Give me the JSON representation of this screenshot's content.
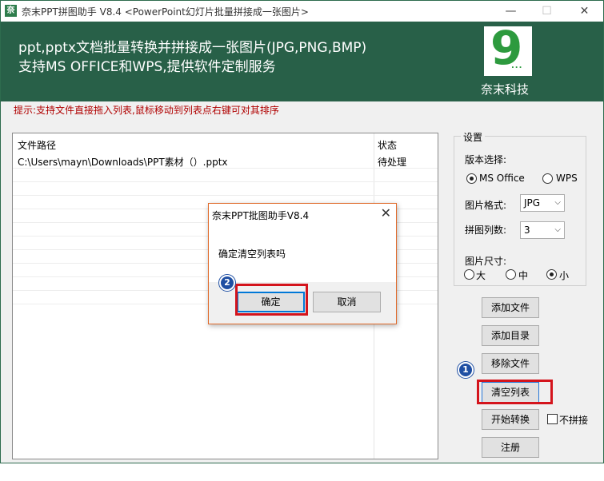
{
  "window": {
    "title": "奈末PPT拼图助手 V8.4 <PowerPoint幻灯片批量拼接成一张图片>",
    "icon_label": "奈",
    "controls": {
      "minimize": "—",
      "maximize": "☐",
      "close": "✕"
    }
  },
  "banner": {
    "line1": "ppt,pptx文档批量转换并拼接成一张图片(JPG,PNG,BMP)",
    "line2": "支持MS OFFICE和WPS,提供软件定制服务",
    "logo_number": "9",
    "logo_dots": "...",
    "logo_text": "奈末科技"
  },
  "hint": "提示:支持文件直接拖入列表,鼠标移动到列表点右键可对其排序",
  "file_list": {
    "columns": [
      "文件路径",
      "状态"
    ],
    "rows": [
      {
        "path": "C:\\Users\\mayn\\Downloads\\PPT素材（）.pptx",
        "status": "待处理"
      }
    ]
  },
  "settings": {
    "title": "设置",
    "version_label": "版本选择:",
    "version_options": [
      "MS Office",
      "WPS"
    ],
    "version_selected": "MS Office",
    "format_label": "图片格式:",
    "format_value": "JPG",
    "columns_label": "拼图列数:",
    "columns_value": "3",
    "size_label": "图片尺寸:",
    "size_options": [
      "大",
      "中",
      "小"
    ],
    "size_selected": "小"
  },
  "buttons": {
    "add_file": "添加文件",
    "add_dir": "添加目录",
    "remove_file": "移除文件",
    "clear_list": "清空列表",
    "start": "开始转换",
    "register": "注册",
    "no_stitch": "不拼接"
  },
  "dialog": {
    "title": "奈末PPT批图助手V8.4",
    "close": "✕",
    "message": "确定清空列表吗",
    "ok": "确定",
    "cancel": "取消"
  },
  "annotations": {
    "badge1": "1",
    "badge2": "2",
    "highlight_color": "#d4141c",
    "badge_color": "#1f4fa3"
  },
  "colors": {
    "banner": "#286048",
    "hint": "#b00000",
    "logo_green": "#2d9a3e"
  }
}
